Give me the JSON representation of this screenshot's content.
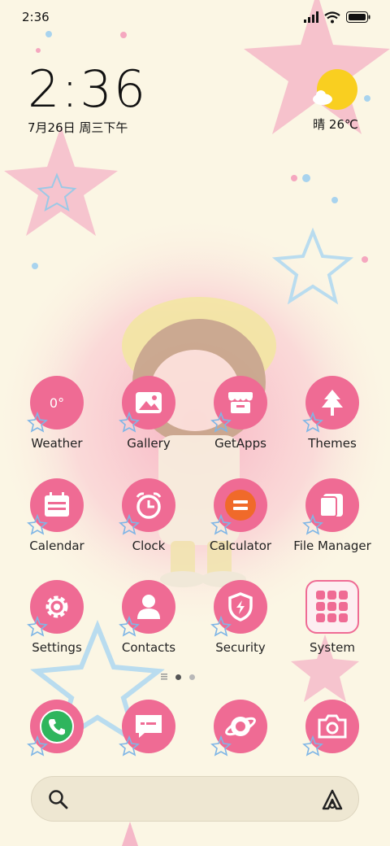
{
  "status_bar": {
    "time": "2:36"
  },
  "clock_widget": {
    "time": "2:36",
    "date": "7月26日 周三下午"
  },
  "weather_widget": {
    "condition_temp": "晴 26℃"
  },
  "apps": {
    "weather": {
      "label": "Weather",
      "icon_text": "0°"
    },
    "gallery": {
      "label": "Gallery"
    },
    "getapps": {
      "label": "GetApps"
    },
    "themes": {
      "label": "Themes"
    },
    "calendar": {
      "label": "Calendar"
    },
    "clock": {
      "label": "Clock"
    },
    "calculator": {
      "label": "Calculator"
    },
    "file_manager": {
      "label": "File Manager"
    },
    "settings": {
      "label": "Settings"
    },
    "contacts": {
      "label": "Contacts"
    },
    "security": {
      "label": "Security"
    },
    "system": {
      "label": "System"
    }
  },
  "dock": [
    "phone-icon",
    "messages-icon",
    "browser-icon",
    "camera-icon"
  ],
  "page_indicator": {
    "pages": 2,
    "active": 1
  },
  "colors": {
    "icon_bg": "#ef6b94",
    "background": "#fbf6e4",
    "star_pink": "#f5b8c8",
    "star_blue": "#b9dcef"
  }
}
